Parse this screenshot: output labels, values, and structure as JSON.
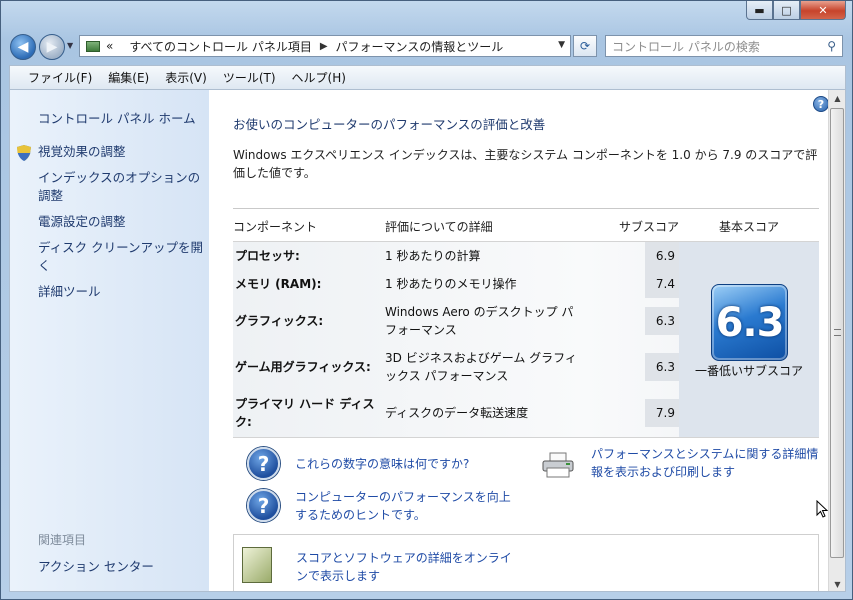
{
  "window": {
    "caption_buttons": {
      "min": "▬",
      "max": "□",
      "close": "✕"
    }
  },
  "nav": {
    "breadcrumb_chevrons": "«",
    "crumb1": "すべてのコントロール パネル項目",
    "crumb2": "パフォーマンスの情報とツール",
    "search_placeholder": "コントロール パネルの検索"
  },
  "menu": [
    "ファイル(F)",
    "編集(E)",
    "表示(V)",
    "ツール(T)",
    "ヘルプ(H)"
  ],
  "sidebar": {
    "home": "コントロール パネル ホーム",
    "items": [
      {
        "label": "視覚効果の調整"
      },
      {
        "label": "インデックスのオプションの調整"
      },
      {
        "label": "電源設定の調整"
      },
      {
        "label": "ディスク クリーンアップを開く"
      },
      {
        "label": "詳細ツール"
      }
    ],
    "related_heading": "関連項目",
    "related_items": [
      {
        "label": "アクション センター"
      }
    ]
  },
  "main": {
    "title": "お使いのコンピューターのパフォーマンスの評価と改善",
    "description": "Windows エクスペリエンス インデックスは、主要なシステム コンポーネントを 1.0 から 7.9 のスコアで評価した値です。",
    "table": {
      "headers": {
        "component": "コンポーネント",
        "detail": "評価についての詳細",
        "subscore": "サブスコア",
        "basescore": "基本スコア"
      },
      "rows": [
        {
          "component": "プロセッサ:",
          "detail": "1 秒あたりの計算",
          "subscore": "6.9"
        },
        {
          "component": "メモリ (RAM):",
          "detail": "1 秒あたりのメモリ操作",
          "subscore": "7.4"
        },
        {
          "component": "グラフィックス:",
          "detail": "Windows Aero のデスクトップ パフォーマンス",
          "subscore": "6.3"
        },
        {
          "component": "ゲーム用グラフィックス:",
          "detail": "3D ビジネスおよびゲーム グラフィックス パフォーマンス",
          "subscore": "6.3"
        },
        {
          "component": "プライマリ ハード ディスク:",
          "detail": "ディスクのデータ転送速度",
          "subscore": "7.9"
        }
      ],
      "base_score": "6.3",
      "base_caption": "一番低いサブスコア"
    },
    "links": {
      "meaning": "これらの数字の意味は何ですか?",
      "tips": "コンピューターのパフォーマンスを向上するためのヒントです。",
      "print": "パフォーマンスとシステムに関する詳細情報を表示および印刷します",
      "online": "スコアとソフトウェアの詳細をオンラインで表示します"
    }
  },
  "colors": {
    "link": "#1f4ba6",
    "sidebar_link": "#1f3a6e",
    "score_tile": "#2a7ad0"
  }
}
